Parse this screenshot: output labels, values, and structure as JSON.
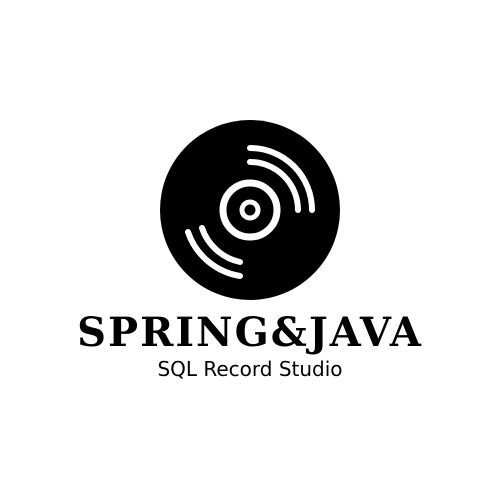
{
  "logo": {
    "icon": "vinyl-record-icon",
    "brand_name": "SPRING&JAVA",
    "tagline": "SQL Record Studio"
  },
  "colors": {
    "background": "#ffffff",
    "foreground": "#000000"
  }
}
